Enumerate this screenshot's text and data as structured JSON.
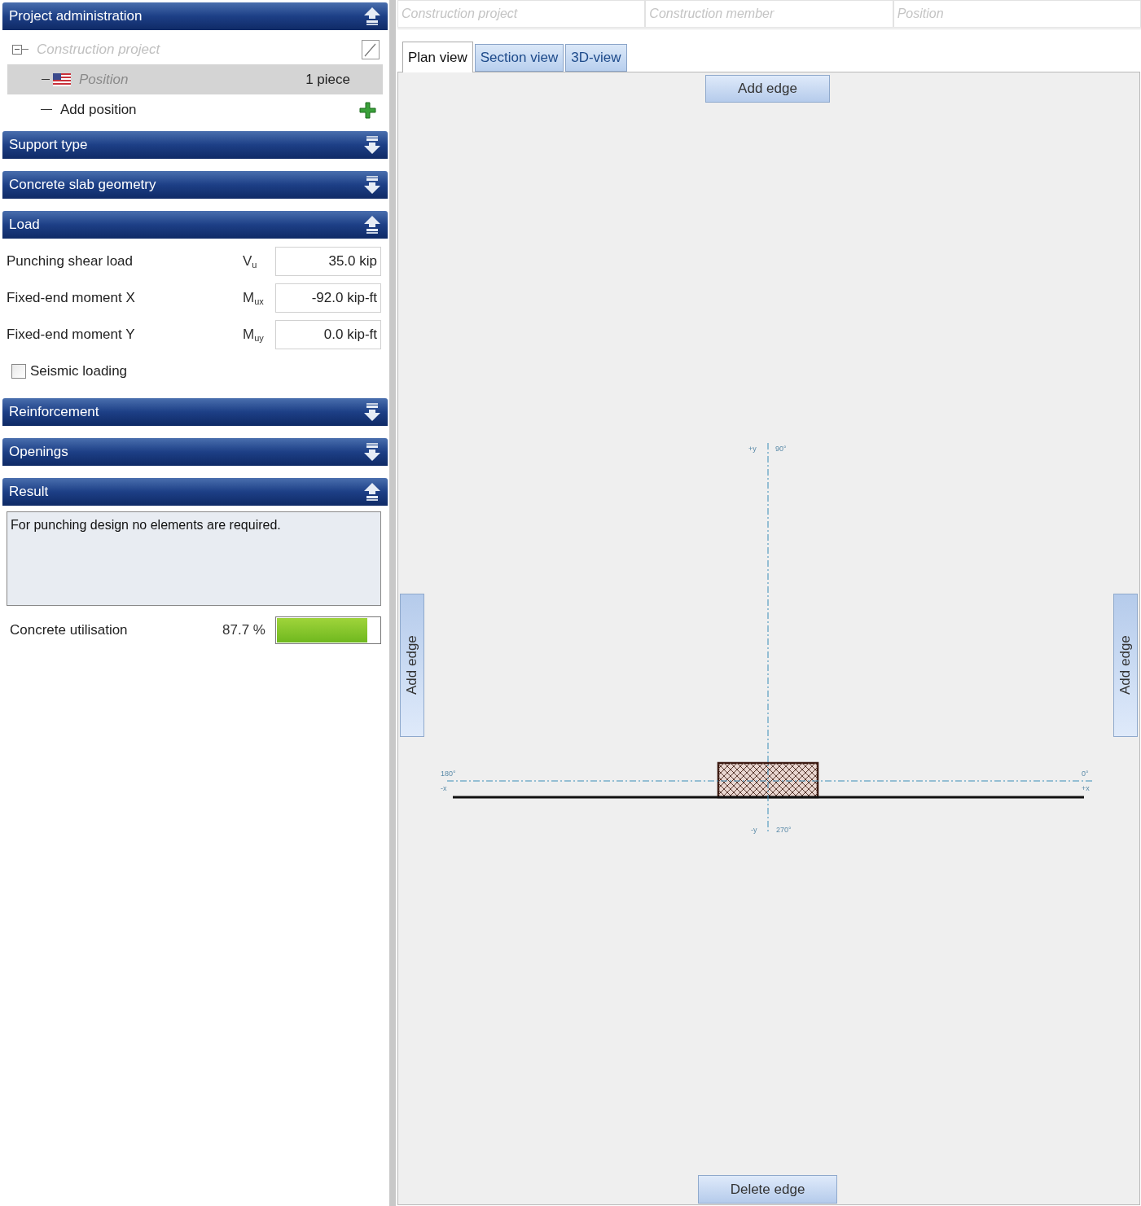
{
  "sections": [
    {
      "title": "Project administration",
      "expanded": true,
      "kind": "project",
      "tree": {
        "label": "Construction project",
        "expanded": true,
        "children": [
          {
            "label": "Position",
            "count": "1 piece",
            "selected": true
          }
        ],
        "add_label": "Add position"
      }
    },
    {
      "title": "Support type",
      "expanded": false
    },
    {
      "title": "Concrete slab geometry",
      "expanded": false
    },
    {
      "title": "Load",
      "expanded": true,
      "kind": "load",
      "fields": [
        {
          "label": "Punching shear load",
          "symbol": "V$_{u}$",
          "value": "35.0 kip"
        },
        {
          "label": "Fixed-end moment X",
          "symbol": "M$_{ux}$",
          "value": "-92.0 kip-ft"
        },
        {
          "label": "Fixed-end moment Y",
          "symbol": "M$_{uy}$",
          "value": "0.0 kip-ft"
        }
      ],
      "checkbox": {
        "label": "Seismic loading",
        "checked": false
      }
    },
    {
      "title": "Reinforcement",
      "expanded": false
    },
    {
      "title": "Openings",
      "expanded": false
    },
    {
      "title": "Result",
      "expanded": true,
      "kind": "result",
      "message": "For punching design no elements are required.",
      "utilisation": {
        "label": "Concrete utilisation",
        "reading": "87.7 %",
        "level": 0.877
      }
    }
  ],
  "header_fields": [
    {
      "placeholder": "Construction project"
    },
    {
      "placeholder": "Construction member"
    },
    {
      "placeholder": "Position"
    }
  ],
  "tabs": [
    {
      "label": "Plan view",
      "selected": true
    },
    {
      "label": "Section view",
      "selected": false
    },
    {
      "label": "3D-view",
      "selected": false
    }
  ],
  "edge_buttons": [
    {
      "label": "Add edge",
      "kind": "top"
    },
    {
      "label": "Add edge",
      "kind": "left"
    },
    {
      "label": "Add edge",
      "kind": "right"
    },
    {
      "label": "Delete edge",
      "kind": "bottom"
    }
  ],
  "axis_labels": {
    "pos_y": "+y",
    "deg_90": "90°",
    "neg_y": "-y",
    "deg_270": "270°",
    "deg_180": "180°",
    "neg_x": "-x",
    "deg_0": "0°",
    "pos_x": "+x"
  }
}
